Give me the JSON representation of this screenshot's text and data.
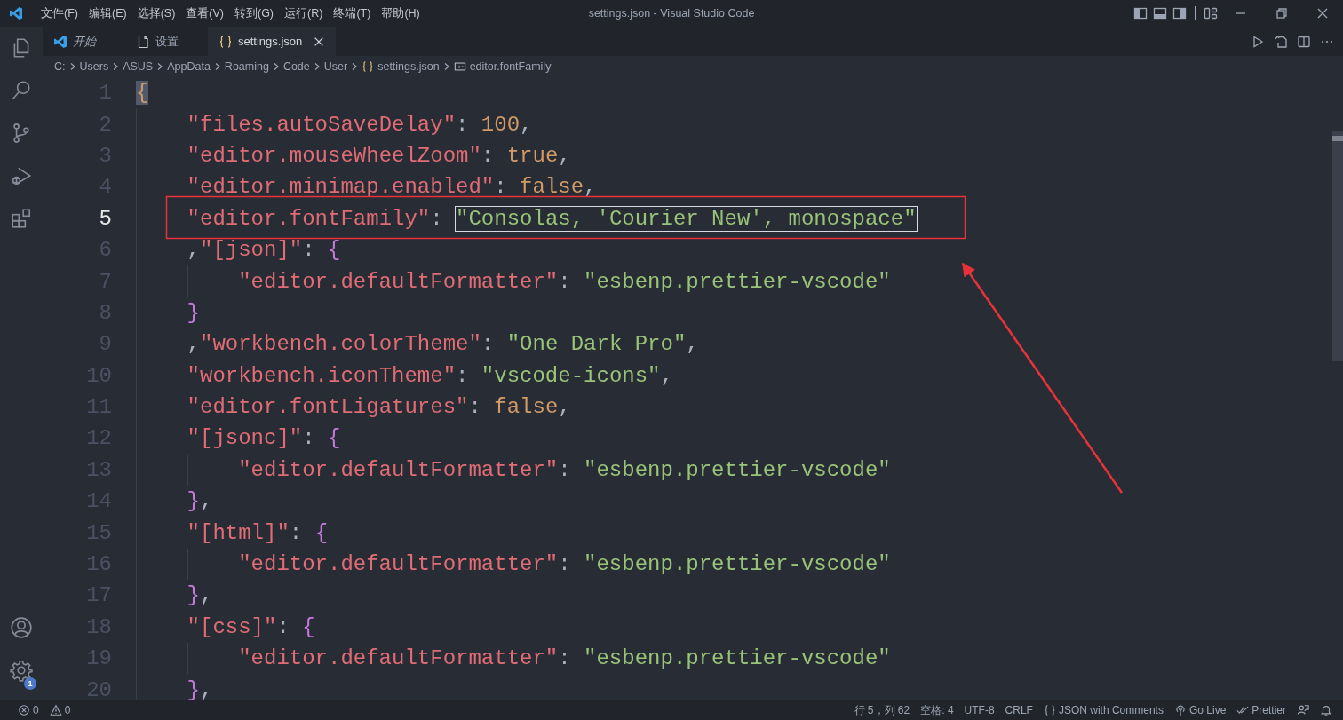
{
  "window": {
    "title": "settings.json - Visual Studio Code"
  },
  "menu": [
    "文件(F)",
    "编辑(E)",
    "选择(S)",
    "查看(V)",
    "转到(G)",
    "运行(R)",
    "终端(T)",
    "帮助(H)"
  ],
  "activity_bar": {
    "settings_badge": "1"
  },
  "tabs": [
    {
      "label": "开始",
      "kind": "welcome",
      "selected": false,
      "preview": true
    },
    {
      "label": "设置",
      "kind": "settings",
      "selected": false,
      "preview": false
    },
    {
      "label": "settings.json",
      "kind": "json",
      "selected": true,
      "preview": false
    }
  ],
  "breadcrumb": [
    {
      "text": "C:",
      "kind": "folder"
    },
    {
      "text": "Users",
      "kind": "folder"
    },
    {
      "text": "ASUS",
      "kind": "folder"
    },
    {
      "text": "AppData",
      "kind": "folder"
    },
    {
      "text": "Roaming",
      "kind": "folder"
    },
    {
      "text": "Code",
      "kind": "folder"
    },
    {
      "text": "User",
      "kind": "folder"
    },
    {
      "text": "settings.json",
      "kind": "json"
    },
    {
      "text": "editor.fontFamily",
      "kind": "string"
    }
  ],
  "editor": {
    "lines": [
      {
        "number": "1",
        "active": false,
        "indented": false,
        "nested": false,
        "tokens": [
          {
            "kind": "match",
            "text": "{"
          }
        ]
      },
      {
        "number": "2",
        "active": false,
        "indented": true,
        "nested": false,
        "tokens": [
          {
            "kind": "key",
            "text": "\"files.autoSaveDelay\""
          },
          {
            "kind": "punct",
            "text": ": "
          },
          {
            "kind": "num",
            "text": "100"
          },
          {
            "kind": "punct",
            "text": ","
          }
        ]
      },
      {
        "number": "3",
        "active": false,
        "indented": true,
        "nested": false,
        "tokens": [
          {
            "kind": "key",
            "text": "\"editor.mouseWheelZoom\""
          },
          {
            "kind": "punct",
            "text": ": "
          },
          {
            "kind": "num",
            "text": "true"
          },
          {
            "kind": "punct",
            "text": ","
          }
        ]
      },
      {
        "number": "4",
        "active": false,
        "indented": true,
        "nested": false,
        "tokens": [
          {
            "kind": "key",
            "text": "\"editor.minimap.enabled\""
          },
          {
            "kind": "punct",
            "text": ": "
          },
          {
            "kind": "num",
            "text": "false"
          },
          {
            "kind": "punct",
            "text": ","
          }
        ]
      },
      {
        "number": "5",
        "active": true,
        "indented": true,
        "nested": false,
        "tokens": [
          {
            "kind": "key",
            "text": "\"editor.fontFamily\""
          },
          {
            "kind": "punct",
            "text": ": "
          },
          {
            "kind": "str",
            "text": "\"Consolas, 'Courier New', monospace\"",
            "boxed": true
          }
        ]
      },
      {
        "number": "6",
        "active": false,
        "indented": true,
        "nested": false,
        "tokens": [
          {
            "kind": "punct",
            "text": ","
          },
          {
            "kind": "key",
            "text": "\"[json]\""
          },
          {
            "kind": "punct",
            "text": ": "
          },
          {
            "kind": "brace",
            "text": "{"
          }
        ]
      },
      {
        "number": "7",
        "active": false,
        "indented": true,
        "nested": true,
        "tokens": [
          {
            "kind": "key",
            "text": "\"editor.defaultFormatter\""
          },
          {
            "kind": "punct",
            "text": ": "
          },
          {
            "kind": "str",
            "text": "\"esbenp.prettier-vscode\""
          }
        ]
      },
      {
        "number": "8",
        "active": false,
        "indented": true,
        "nested": false,
        "tokens": [
          {
            "kind": "brace",
            "text": "}"
          }
        ]
      },
      {
        "number": "9",
        "active": false,
        "indented": true,
        "nested": false,
        "tokens": [
          {
            "kind": "punct",
            "text": ","
          },
          {
            "kind": "key",
            "text": "\"workbench.colorTheme\""
          },
          {
            "kind": "punct",
            "text": ": "
          },
          {
            "kind": "str",
            "text": "\"One Dark Pro\""
          },
          {
            "kind": "punct",
            "text": ","
          }
        ]
      },
      {
        "number": "10",
        "active": false,
        "indented": true,
        "nested": false,
        "tokens": [
          {
            "kind": "key",
            "text": "\"workbench.iconTheme\""
          },
          {
            "kind": "punct",
            "text": ": "
          },
          {
            "kind": "str",
            "text": "\"vscode-icons\""
          },
          {
            "kind": "punct",
            "text": ","
          }
        ]
      },
      {
        "number": "11",
        "active": false,
        "indented": true,
        "nested": false,
        "tokens": [
          {
            "kind": "key",
            "text": "\"editor.fontLigatures\""
          },
          {
            "kind": "punct",
            "text": ": "
          },
          {
            "kind": "num",
            "text": "false"
          },
          {
            "kind": "punct",
            "text": ","
          }
        ]
      },
      {
        "number": "12",
        "active": false,
        "indented": true,
        "nested": false,
        "tokens": [
          {
            "kind": "key",
            "text": "\"[jsonc]\""
          },
          {
            "kind": "punct",
            "text": ": "
          },
          {
            "kind": "brace",
            "text": "{"
          }
        ]
      },
      {
        "number": "13",
        "active": false,
        "indented": true,
        "nested": true,
        "tokens": [
          {
            "kind": "key",
            "text": "\"editor.defaultFormatter\""
          },
          {
            "kind": "punct",
            "text": ": "
          },
          {
            "kind": "str",
            "text": "\"esbenp.prettier-vscode\""
          }
        ]
      },
      {
        "number": "14",
        "active": false,
        "indented": true,
        "nested": false,
        "tokens": [
          {
            "kind": "brace",
            "text": "}"
          },
          {
            "kind": "punct",
            "text": ","
          }
        ]
      },
      {
        "number": "15",
        "active": false,
        "indented": true,
        "nested": false,
        "tokens": [
          {
            "kind": "key",
            "text": "\"[html]\""
          },
          {
            "kind": "punct",
            "text": ": "
          },
          {
            "kind": "brace",
            "text": "{"
          }
        ]
      },
      {
        "number": "16",
        "active": false,
        "indented": true,
        "nested": true,
        "tokens": [
          {
            "kind": "key",
            "text": "\"editor.defaultFormatter\""
          },
          {
            "kind": "punct",
            "text": ": "
          },
          {
            "kind": "str",
            "text": "\"esbenp.prettier-vscode\""
          }
        ]
      },
      {
        "number": "17",
        "active": false,
        "indented": true,
        "nested": false,
        "tokens": [
          {
            "kind": "brace",
            "text": "}"
          },
          {
            "kind": "punct",
            "text": ","
          }
        ]
      },
      {
        "number": "18",
        "active": false,
        "indented": true,
        "nested": false,
        "tokens": [
          {
            "kind": "key",
            "text": "\"[css]\""
          },
          {
            "kind": "punct",
            "text": ": "
          },
          {
            "kind": "brace",
            "text": "{"
          }
        ]
      },
      {
        "number": "19",
        "active": false,
        "indented": true,
        "nested": true,
        "tokens": [
          {
            "kind": "key",
            "text": "\"editor.defaultFormatter\""
          },
          {
            "kind": "punct",
            "text": ": "
          },
          {
            "kind": "str",
            "text": "\"esbenp.prettier-vscode\""
          }
        ]
      },
      {
        "number": "20",
        "active": false,
        "indented": true,
        "nested": false,
        "tokens": [
          {
            "kind": "brace",
            "text": "}"
          },
          {
            "kind": "punct",
            "text": ","
          }
        ]
      }
    ]
  },
  "status_bar": {
    "left": [
      {
        "kind": "errors",
        "text": "0"
      },
      {
        "kind": "warnings",
        "text": "0"
      }
    ],
    "right": [
      {
        "kind": "plain",
        "text": "行 5，列 62"
      },
      {
        "kind": "plain",
        "text": "空格: 4"
      },
      {
        "kind": "plain",
        "text": "UTF-8"
      },
      {
        "kind": "plain",
        "text": "CRLF"
      },
      {
        "kind": "language",
        "text": "JSON with Comments"
      },
      {
        "kind": "live",
        "text": "Go Live"
      },
      {
        "kind": "prettier",
        "text": "Prettier"
      },
      {
        "kind": "feedback"
      },
      {
        "kind": "bell"
      }
    ]
  }
}
